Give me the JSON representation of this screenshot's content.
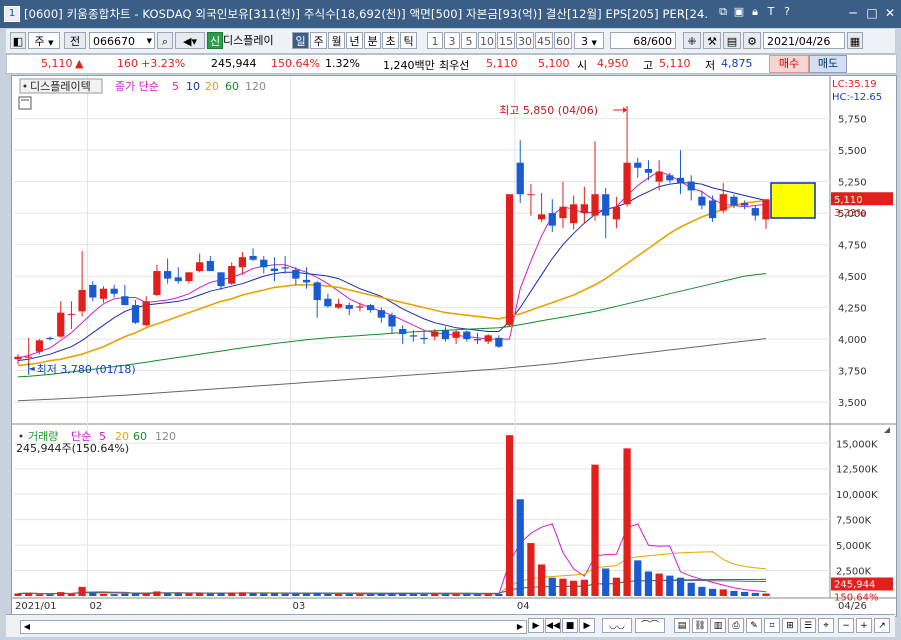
{
  "window": {
    "number": "1",
    "title": "[0600] 키움종합차트 - KOSDAQ 외국인보유[311(천)] 주식수[18,692(천)] 액면[500] 자본금[93(억)] 결산[12월] EPS[205] PER[24."
  },
  "toolbar": {
    "period_selector": "주",
    "prev_label": "전",
    "code": "066670",
    "credit_badge": "신",
    "name": "디스플레이",
    "intervals": [
      "일",
      "주",
      "월",
      "년",
      "분",
      "초",
      "틱"
    ],
    "active_interval": "일",
    "minute_options": [
      "1",
      "3",
      "5",
      "10",
      "15",
      "30",
      "45",
      "60"
    ],
    "ticks_value": "3",
    "count": "68/600",
    "date": "2021/04/26"
  },
  "quote": {
    "price": "5,110",
    "arrow": "▲",
    "change": "160",
    "change_pct": "+3.23%",
    "volume": "245,944",
    "volume_ratio": "150.64%",
    "turnover": "1.32%",
    "amount": "1,240백만",
    "best_ask_label": "최우선",
    "ask": "5,110",
    "bid": "5,100",
    "open_label": "시",
    "open": "4,950",
    "high_label": "고",
    "high": "5,110",
    "low_label": "저",
    "low": "4,875",
    "buy_label": "매수",
    "sell_label": "매도"
  },
  "chart_data": [
    {
      "type": "candlestick",
      "title": "디스플레이텍",
      "legend": {
        "label": "종가 단순",
        "periods": [
          "5",
          "10",
          "20",
          "60",
          "120"
        ]
      },
      "indicators": {
        "lc": "LC:35.19",
        "hc": "HC:-12.65"
      },
      "y_ticks": [
        "5,750",
        "5,500",
        "5,250",
        "5,000",
        "4,750",
        "4,500",
        "4,250",
        "4,000",
        "3,750",
        "3,500"
      ],
      "ylim": [
        3350,
        5850
      ],
      "current_price_label": "5,110",
      "current_pct_label": "3.23%",
      "annotations": [
        {
          "text": "최고 5,850 (04/06)"
        },
        {
          "text": "최저 3,780 (01/18)"
        }
      ],
      "candles": [
        [
          3840,
          3880,
          3800,
          3860
        ],
        [
          3860,
          4010,
          3780,
          3860
        ],
        [
          3900,
          4000,
          3880,
          3990
        ],
        [
          4010,
          4020,
          3990,
          4000
        ],
        [
          4020,
          4300,
          4010,
          4210
        ],
        [
          4200,
          4300,
          4080,
          4200
        ],
        [
          4220,
          4700,
          4180,
          4390
        ],
        [
          4430,
          4460,
          4300,
          4330
        ],
        [
          4320,
          4420,
          4290,
          4400
        ],
        [
          4400,
          4430,
          4330,
          4360
        ],
        [
          4340,
          4430,
          4270,
          4270
        ],
        [
          4270,
          4310,
          4120,
          4130
        ],
        [
          4110,
          4340,
          4100,
          4300
        ],
        [
          4350,
          4590,
          4340,
          4540
        ],
        [
          4540,
          4640,
          4440,
          4480
        ],
        [
          4490,
          4570,
          4440,
          4460
        ],
        [
          4460,
          4530,
          4440,
          4530
        ],
        [
          4540,
          4680,
          4530,
          4610
        ],
        [
          4620,
          4660,
          4540,
          4540
        ],
        [
          4530,
          4530,
          4390,
          4420
        ],
        [
          4440,
          4610,
          4430,
          4580
        ],
        [
          4570,
          4690,
          4510,
          4650
        ],
        [
          4660,
          4720,
          4620,
          4630
        ],
        [
          4630,
          4660,
          4520,
          4570
        ],
        [
          4560,
          4650,
          4460,
          4540
        ],
        [
          4570,
          4660,
          4520,
          4560
        ],
        [
          4550,
          4570,
          4430,
          4480
        ],
        [
          4470,
          4570,
          4400,
          4450
        ],
        [
          4450,
          4460,
          4170,
          4310
        ],
        [
          4320,
          4360,
          4250,
          4260
        ],
        [
          4250,
          4320,
          4240,
          4280
        ],
        [
          4270,
          4290,
          4190,
          4240
        ],
        [
          4250,
          4290,
          4220,
          4260
        ],
        [
          4270,
          4280,
          4210,
          4230
        ],
        [
          4230,
          4250,
          4130,
          4170
        ],
        [
          4190,
          4210,
          4040,
          4100
        ],
        [
          4080,
          4110,
          3960,
          4040
        ],
        [
          4030,
          4070,
          3980,
          4020
        ],
        [
          4010,
          4060,
          3960,
          4000
        ],
        [
          4020,
          4080,
          3990,
          4060
        ],
        [
          4070,
          4100,
          3980,
          4000
        ],
        [
          4010,
          4070,
          3960,
          4060
        ],
        [
          4060,
          4070,
          3980,
          4000
        ],
        [
          4000,
          4050,
          3960,
          3990
        ],
        [
          3980,
          4040,
          3960,
          4030
        ],
        [
          4010,
          4030,
          3930,
          3940
        ],
        [
          4110,
          4990,
          4100,
          5150
        ],
        [
          5400,
          5580,
          5080,
          5150
        ],
        [
          5150,
          5230,
          4980,
          5150
        ],
        [
          4950,
          5160,
          4930,
          4990
        ],
        [
          5000,
          5110,
          4850,
          4900
        ],
        [
          4960,
          5250,
          4880,
          5050
        ],
        [
          4920,
          5140,
          4870,
          5070
        ],
        [
          5000,
          5210,
          4920,
          5070
        ],
        [
          4980,
          5570,
          4940,
          5150
        ],
        [
          5150,
          5200,
          4800,
          4980
        ],
        [
          4950,
          5130,
          4880,
          5050
        ],
        [
          5070,
          5850,
          5050,
          5400
        ],
        [
          5400,
          5440,
          5280,
          5360
        ],
        [
          5350,
          5420,
          5260,
          5320
        ],
        [
          5250,
          5420,
          5180,
          5330
        ],
        [
          5300,
          5320,
          5240,
          5260
        ],
        [
          5280,
          5500,
          5150,
          5240
        ],
        [
          5250,
          5300,
          5100,
          5180
        ],
        [
          5130,
          5180,
          5030,
          5060
        ],
        [
          5100,
          5140,
          4930,
          4960
        ],
        [
          5020,
          5240,
          5000,
          5150
        ],
        [
          5130,
          5150,
          5040,
          5060
        ],
        [
          5080,
          5100,
          5030,
          5060
        ],
        [
          5040,
          5060,
          4940,
          4980
        ],
        [
          4950,
          5110,
          4875,
          5110
        ]
      ],
      "ma5": [
        3850,
        3870,
        3900,
        3930,
        3990,
        4050,
        4130,
        4210,
        4280,
        4320,
        4330,
        4330,
        4290,
        4300,
        4310,
        4330,
        4360,
        4410,
        4450,
        4470,
        4490,
        4520,
        4560,
        4580,
        4590,
        4590,
        4560,
        4530,
        4490,
        4440,
        4380,
        4320,
        4280,
        4250,
        4220,
        4190,
        4150,
        4110,
        4070,
        4050,
        4040,
        4030,
        4020,
        4010,
        4000,
        4000,
        4000,
        4400,
        4620,
        4820,
        4980,
        5050,
        5030,
        5000,
        5010,
        5030,
        5050,
        5140,
        5220,
        5280,
        5330,
        5300,
        5250,
        5200,
        5170,
        5110,
        5070,
        5060,
        5050,
        5060,
        5070
      ],
      "ma10": [
        3830,
        3840,
        3860,
        3880,
        3910,
        3940,
        3990,
        4050,
        4110,
        4170,
        4220,
        4250,
        4270,
        4280,
        4290,
        4300,
        4320,
        4350,
        4380,
        4400,
        4420,
        4440,
        4470,
        4500,
        4520,
        4530,
        4530,
        4520,
        4510,
        4500,
        4480,
        4440,
        4400,
        4370,
        4340,
        4290,
        4240,
        4200,
        4160,
        4130,
        4110,
        4090,
        4080,
        4070,
        4060,
        4060,
        4140,
        4250,
        4380,
        4510,
        4640,
        4750,
        4840,
        4920,
        4990,
        5030,
        5050,
        5080,
        5130,
        5170,
        5210,
        5230,
        5240,
        5240,
        5230,
        5200,
        5180,
        5160,
        5140,
        5120,
        5100
      ],
      "ma20": [
        3790,
        3800,
        3810,
        3830,
        3840,
        3860,
        3880,
        3910,
        3940,
        3980,
        4020,
        4050,
        4090,
        4120,
        4150,
        4180,
        4210,
        4240,
        4270,
        4300,
        4320,
        4350,
        4370,
        4390,
        4410,
        4420,
        4430,
        4430,
        4430,
        4420,
        4410,
        4390,
        4370,
        4350,
        4330,
        4310,
        4290,
        4270,
        4250,
        4230,
        4210,
        4200,
        4190,
        4180,
        4170,
        4160,
        4180,
        4200,
        4230,
        4260,
        4290,
        4320,
        4350,
        4390,
        4430,
        4480,
        4540,
        4600,
        4660,
        4720,
        4780,
        4840,
        4890,
        4930,
        4970,
        5000,
        5030,
        5060,
        5080,
        5090,
        5100
      ],
      "ma60": [
        3700,
        3705,
        3712,
        3720,
        3730,
        3740,
        3750,
        3760,
        3770,
        3782,
        3793,
        3805,
        3817,
        3830,
        3842,
        3855,
        3867,
        3880,
        3893,
        3905,
        3918,
        3930,
        3942,
        3953,
        3965,
        3975,
        3985,
        3995,
        4003,
        4010,
        4017,
        4022,
        4028,
        4034,
        4040,
        4046,
        4052,
        4057,
        4062,
        4066,
        4070,
        4074,
        4078,
        4082,
        4086,
        4090,
        4100,
        4115,
        4130,
        4145,
        4160,
        4175,
        4190,
        4205,
        4220,
        4240,
        4260,
        4280,
        4300,
        4320,
        4340,
        4360,
        4380,
        4400,
        4420,
        4440,
        4460,
        4480,
        4500,
        4510,
        4520
      ],
      "ma120": [
        3510,
        3514,
        3518,
        3522,
        3526,
        3530,
        3535,
        3540,
        3545,
        3550,
        3555,
        3560,
        3566,
        3572,
        3578,
        3584,
        3590,
        3596,
        3602,
        3608,
        3614,
        3620,
        3626,
        3632,
        3638,
        3644,
        3650,
        3656,
        3662,
        3668,
        3674,
        3680,
        3686,
        3692,
        3698,
        3704,
        3710,
        3716,
        3722,
        3728,
        3734,
        3740,
        3746,
        3752,
        3758,
        3764,
        3772,
        3780,
        3788,
        3796,
        3804,
        3814,
        3824,
        3834,
        3844,
        3854,
        3864,
        3874,
        3884,
        3894,
        3904,
        3914,
        3924,
        3934,
        3944,
        3954,
        3964,
        3974,
        3984,
        3994,
        4004
      ]
    },
    {
      "type": "bar",
      "title": "거래량",
      "legend": {
        "label": "단순",
        "periods": [
          "5",
          "20",
          "60",
          "120"
        ]
      },
      "value_label": "245,944주(150.64%)",
      "y_ticks": [
        "15,000K",
        "12,500K",
        "10,000K",
        "7,500K",
        "5,000K",
        "2,500K"
      ],
      "ylim": [
        0,
        16500
      ],
      "current_label": "245,944",
      "current_pct_label": "150.64%",
      "values": [
        250,
        300,
        180,
        150,
        380,
        200,
        900,
        330,
        200,
        180,
        230,
        270,
        280,
        450,
        260,
        250,
        270,
        300,
        250,
        280,
        330,
        350,
        280,
        240,
        260,
        230,
        250,
        250,
        330,
        220,
        200,
        200,
        190,
        180,
        210,
        250,
        230,
        200,
        190,
        200,
        180,
        190,
        200,
        180,
        190,
        200,
        15800,
        9500,
        5200,
        3100,
        1800,
        1700,
        1500,
        1600,
        12900,
        2700,
        1800,
        14500,
        3500,
        2400,
        2200,
        2000,
        1800,
        1300,
        900,
        700,
        650,
        500,
        400,
        300,
        246
      ],
      "x_labels": [
        "2021/01",
        "02",
        "03",
        "04",
        "04/26"
      ]
    }
  ]
}
